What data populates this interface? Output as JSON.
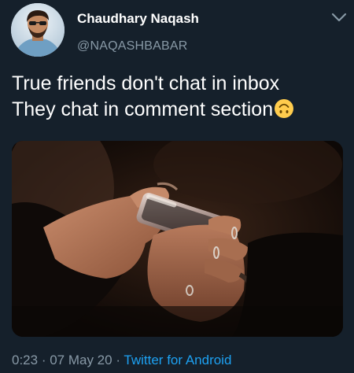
{
  "author": {
    "name": "Chaudhary Naqash",
    "handle": "@NAQASHBABAR",
    "avatar_icon": "profile-photo"
  },
  "menu": {
    "icon": "chevron-down-icon"
  },
  "tweet": {
    "lines": [
      "True friends don't chat in inbox",
      "They chat in comment section"
    ],
    "emoji": "upside-down-face"
  },
  "media": {
    "type": "photo",
    "subject": "hands-holding-phone"
  },
  "meta": {
    "time": "0:23",
    "separator1": " · ",
    "date": "07 May 20",
    "separator2": " · ",
    "source": "Twitter for Android"
  },
  "colors": {
    "background": "#15202b",
    "secondary_text": "#8899a6",
    "link": "#1da1f2"
  }
}
